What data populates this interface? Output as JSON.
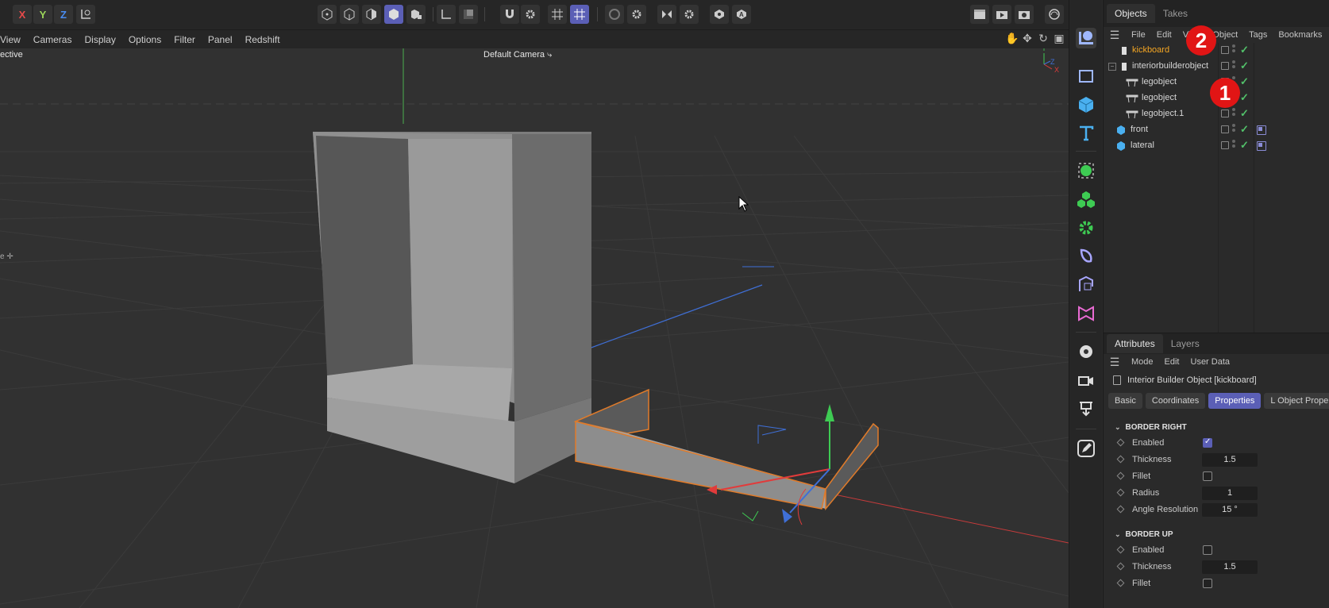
{
  "toolbar": {
    "axis_x": "X",
    "axis_y": "Y",
    "axis_z": "Z",
    "axis_x_color": "#e84a4a",
    "axis_y_color": "#9bd45a",
    "axis_z_color": "#4a8df2",
    "active_color": "#5b5fb6"
  },
  "viewport_menu": [
    "View",
    "Cameras",
    "Display",
    "Options",
    "Filter",
    "Panel",
    "Redshift"
  ],
  "viewport": {
    "projection_label": "ective",
    "camera_label": "Default Camera"
  },
  "objects_panel": {
    "tabs": [
      "Objects",
      "Takes"
    ],
    "menu": [
      "File",
      "Edit",
      "View",
      "Object",
      "Tags",
      "Bookmarks"
    ],
    "items": [
      {
        "name": "kickboard",
        "selected": true,
        "icon": "object-icon"
      },
      {
        "name": "interiorbuilderobject",
        "selected": false,
        "icon": "object-icon"
      },
      {
        "name": "legobject",
        "selected": false,
        "icon": "leg-icon"
      },
      {
        "name": "legobject",
        "selected": false,
        "icon": "leg-icon"
      },
      {
        "name": "legobject.1",
        "selected": false,
        "icon": "leg-icon"
      },
      {
        "name": "front",
        "selected": false,
        "icon": "cube-icon"
      },
      {
        "name": "lateral",
        "selected": false,
        "icon": "cube-icon"
      }
    ],
    "selected_color": "#f5a623",
    "badges": [
      "2",
      "1"
    ]
  },
  "attributes_panel": {
    "tabs": [
      "Attributes",
      "Layers"
    ],
    "menu": [
      "Mode",
      "Edit",
      "User Data"
    ],
    "object_title": "Interior Builder Object [kickboard]",
    "subtabs": [
      "Basic",
      "Coordinates",
      "Properties",
      "L Object Prope"
    ],
    "groups": [
      {
        "title": "BORDER RIGHT",
        "props": [
          {
            "label": "Enabled",
            "type": "checkbox",
            "checked": true
          },
          {
            "label": "Thickness",
            "type": "value",
            "value": "1.5"
          },
          {
            "label": "Fillet",
            "type": "checkbox",
            "checked": false
          },
          {
            "label": "Radius",
            "type": "value",
            "value": "1"
          },
          {
            "label": "Angle Resolution",
            "type": "value",
            "value": "15 °"
          }
        ]
      },
      {
        "title": "BORDER UP",
        "props": [
          {
            "label": "Enabled",
            "type": "checkbox",
            "checked": false
          },
          {
            "label": "Thickness",
            "type": "value",
            "value": "1.5"
          },
          {
            "label": "Fillet",
            "type": "checkbox",
            "checked": false
          }
        ]
      }
    ]
  }
}
